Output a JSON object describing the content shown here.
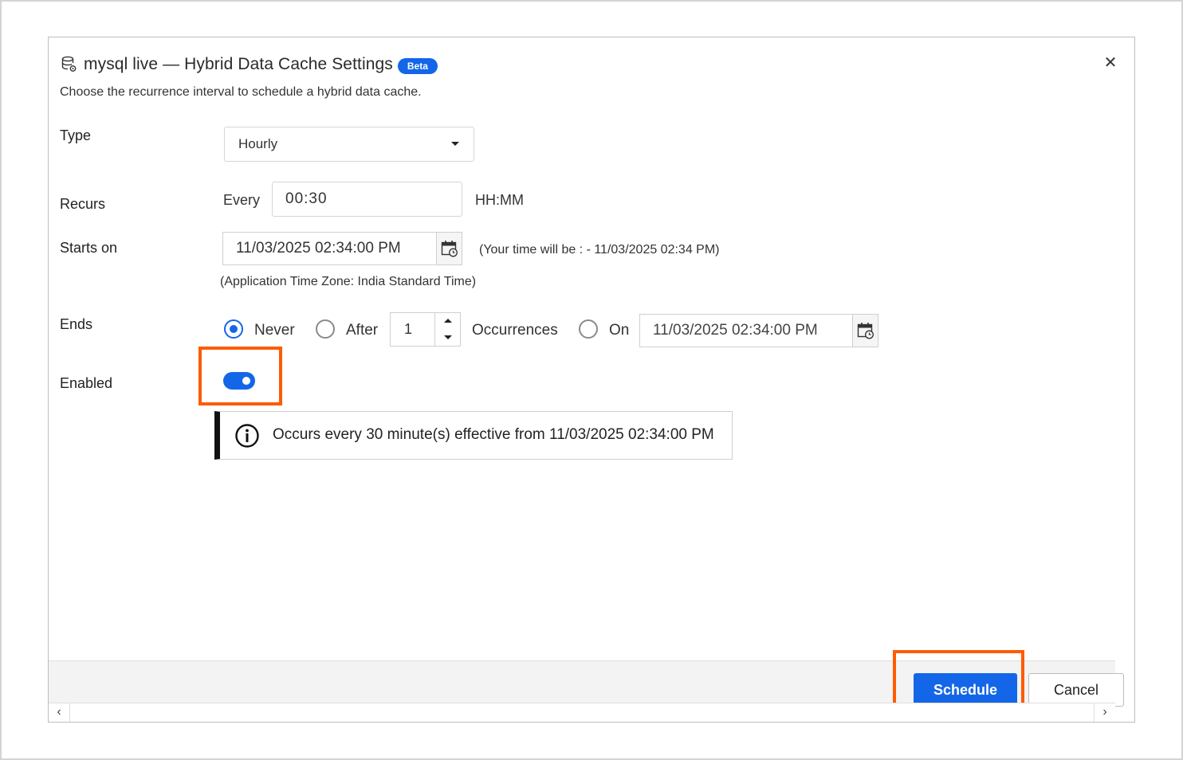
{
  "dialog": {
    "title": "mysql live — Hybrid Data Cache Settings",
    "badge": "Beta",
    "subtitle": "Choose the recurrence interval to schedule a hybrid data cache.",
    "close_glyph": "✕"
  },
  "form": {
    "type": {
      "label": "Type",
      "value": "Hourly"
    },
    "recurs": {
      "label": "Recurs",
      "prefix": "Every",
      "value": "00:30",
      "unit": "HH:MM"
    },
    "starts_on": {
      "label": "Starts on",
      "value": "11/03/2025 02:34:00 PM",
      "local_time_note": "(Your time will be : - 11/03/2025 02:34 PM)",
      "timezone_note": "(Application Time Zone: India Standard Time)"
    },
    "ends": {
      "label": "Ends",
      "options": [
        {
          "label": "Never",
          "checked": true
        },
        {
          "label": "After",
          "checked": false
        },
        {
          "label": "On",
          "checked": false
        }
      ],
      "occurrences_value": "1",
      "occurrences_label": "Occurrences",
      "end_date": "11/03/2025 02:34:00 PM"
    },
    "enabled": {
      "label": "Enabled",
      "on": true
    }
  },
  "info": {
    "text": "Occurs every 30 minute(s) effective from 11/03/2025 02:34:00 PM"
  },
  "footer": {
    "schedule_label": "Schedule",
    "cancel_label": "Cancel"
  },
  "scroll": {
    "left_glyph": "‹",
    "right_glyph": "›"
  },
  "colors": {
    "accent": "#1466e8",
    "highlight": "#ff5b00"
  },
  "icons": {
    "title": "database-settings-icon",
    "calendar": "calendar-clock-icon",
    "info": "info-circle-icon"
  }
}
